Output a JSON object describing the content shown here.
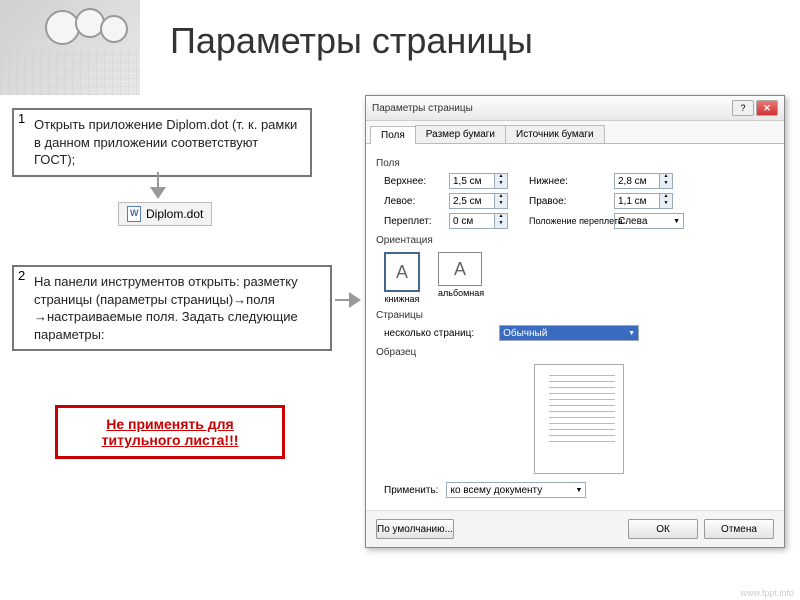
{
  "header": {
    "title": "Параметры страницы"
  },
  "step1": {
    "num": "1",
    "text": "Открыть приложение Diplom.dot (т. к. рамки в данном приложении соответствуют ГОСТ);"
  },
  "file": {
    "name": "Diplom.dot"
  },
  "step2": {
    "num": "2",
    "text": "На панели инструментов открыть: разметку страницы (параметры страницы)→поля →настраиваемые поля. Задать следующие параметры:"
  },
  "warning": {
    "line1": "Не применять для",
    "line2": "титульного листа!!!"
  },
  "dialog": {
    "title": "Параметры страницы",
    "help": "?",
    "close": "✕",
    "tabs": {
      "t1": "Поля",
      "t2": "Размер бумаги",
      "t3": "Источник бумаги"
    },
    "section_fields": "Поля",
    "margins": {
      "top_lbl": "Верхнее:",
      "top": "1,5 см",
      "bottom_lbl": "Нижнее:",
      "bottom": "2,8 см",
      "left_lbl": "Левое:",
      "left": "2,5 см",
      "right_lbl": "Правое:",
      "right": "1,1 см",
      "gutter_lbl": "Переплет:",
      "gutter": "0 см",
      "gutter_pos_lbl": "Положение переплета:",
      "gutter_pos": "Слева"
    },
    "section_orient": "Ориентация",
    "orient": {
      "portrait": "книжная",
      "landscape": "альбомная",
      "glyph": "A"
    },
    "section_pages": "Страницы",
    "pages": {
      "multi_lbl": "несколько страниц:",
      "value": "Обычный"
    },
    "section_preview": "Образец",
    "apply": {
      "lbl": "Применить:",
      "value": "ко всему документу"
    },
    "buttons": {
      "default": "По умолчанию...",
      "ok": "ОК",
      "cancel": "Отмена"
    }
  },
  "watermark": "www.fppt.info"
}
